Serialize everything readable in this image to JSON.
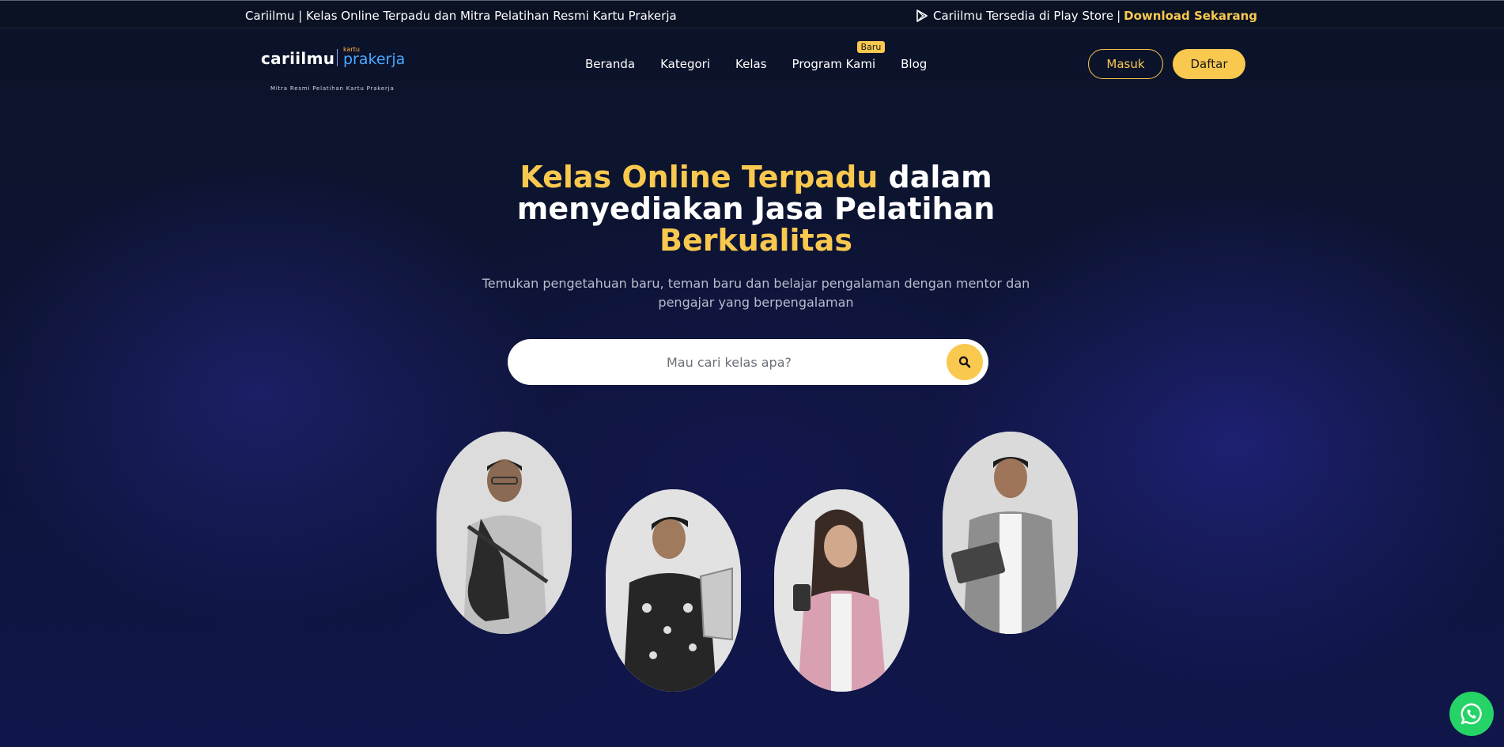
{
  "topbar": {
    "tagline": "Cariilmu | Kelas Online Terpadu dan Mitra Pelatihan Resmi Kartu Prakerja",
    "playstore_text": "Cariilmu Tersedia di Play Store",
    "separator": "|",
    "download_link": "Download Sekarang",
    "icon": "play-store-icon"
  },
  "logo": {
    "main": "cariilmu",
    "kartu": "kartu",
    "prakerja": "prakerja",
    "subtitle": "Mitra Resmi Pelatihan Kartu Prakerja"
  },
  "nav": {
    "items": [
      "Beranda",
      "Kategori",
      "Kelas",
      "Program Kami",
      "Blog"
    ],
    "badge": "Baru"
  },
  "auth": {
    "login": "Masuk",
    "register": "Daftar"
  },
  "hero": {
    "title_highlight_1": "Kelas Online Terpadu",
    "title_normal_1": " dalam menyediakan Jasa Pelatihan ",
    "title_highlight_2": "Berkualitas",
    "subtitle": "Temukan pengetahuan baru, teman baru dan belajar pengalaman dengan mentor dan pengajar yang berpengalaman"
  },
  "search": {
    "placeholder": "Mau cari kelas apa?",
    "icon": "search-icon"
  },
  "colors": {
    "accent": "#f9c84f",
    "background": "#0b1328",
    "whatsapp": "#25d366"
  },
  "floating": {
    "icon": "whatsapp-icon"
  }
}
